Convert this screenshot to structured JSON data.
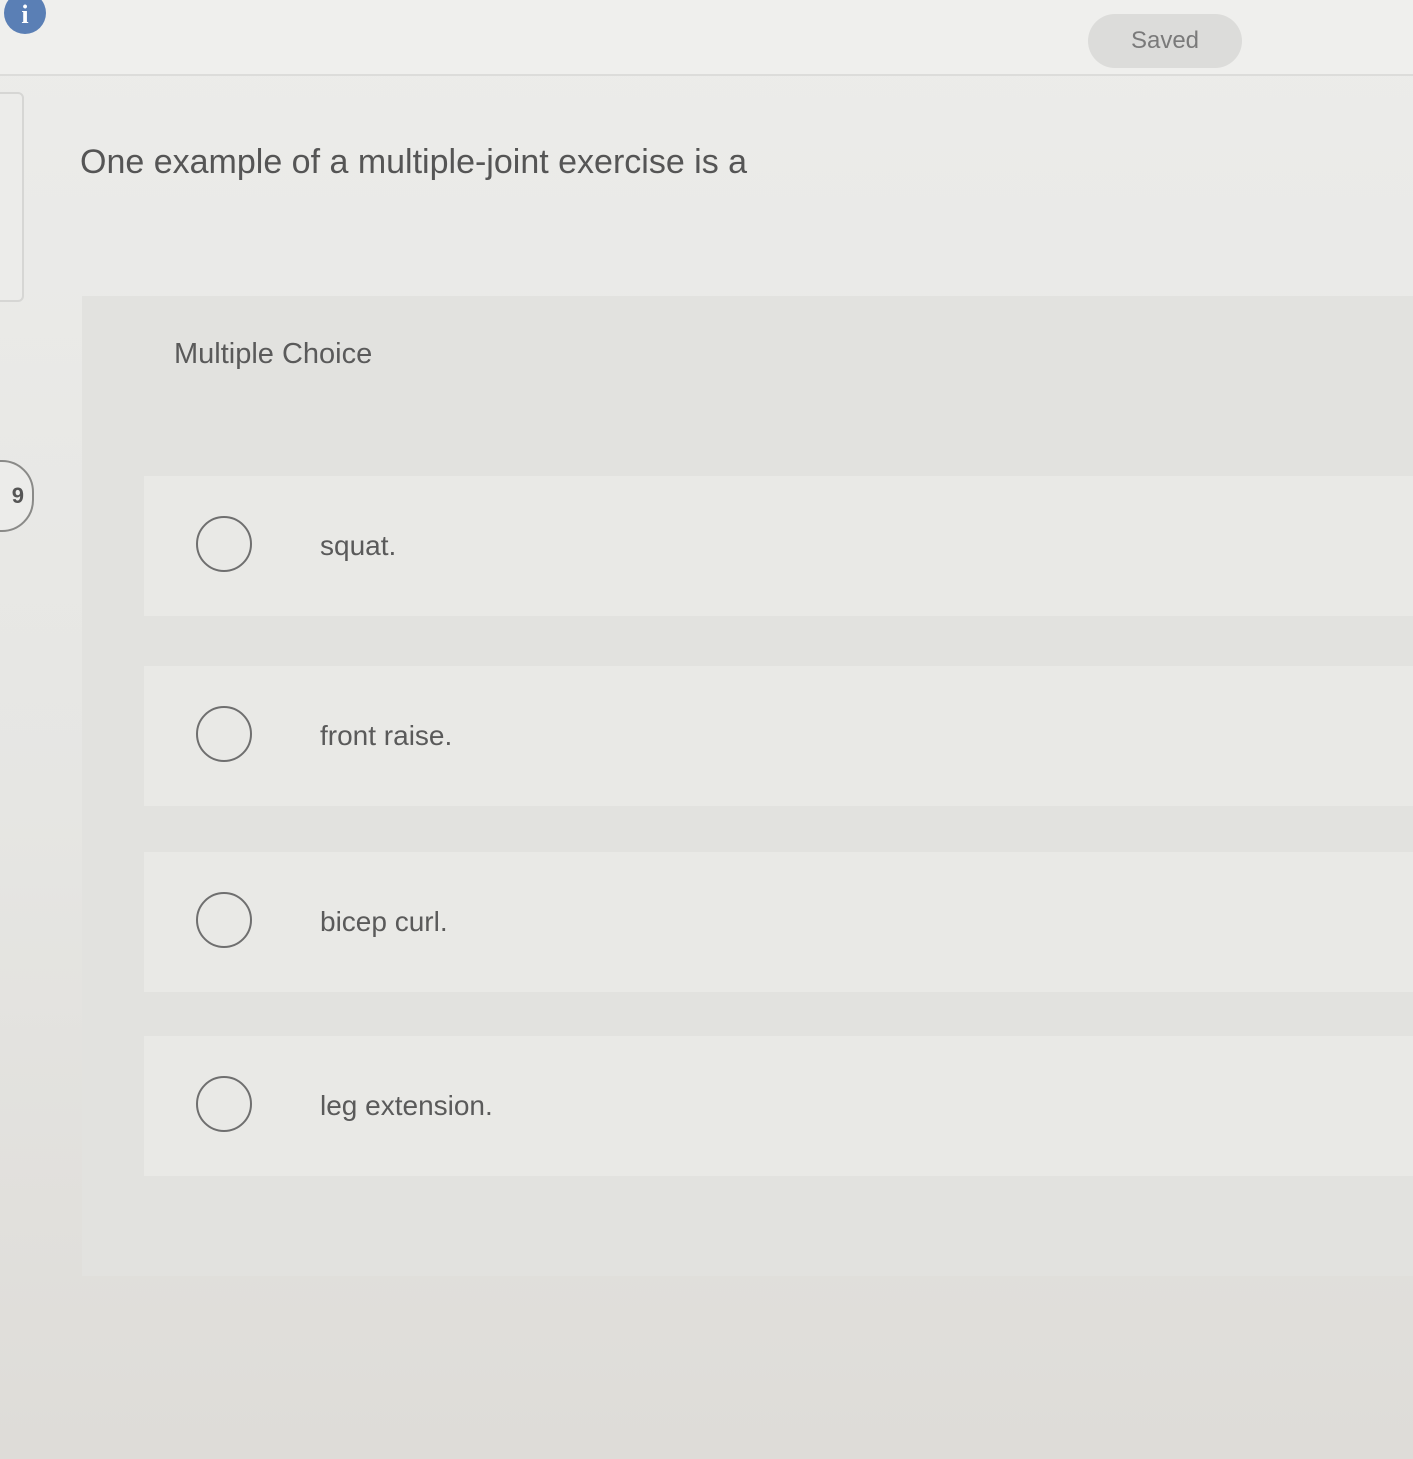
{
  "header": {
    "info_icon": "info-icon",
    "info_label": "i",
    "status": "Saved"
  },
  "question": {
    "number": "9",
    "text": "One example of a multiple-joint exercise is a"
  },
  "answer_panel": {
    "type_label": "Multiple Choice",
    "options": [
      {
        "label": "squat.",
        "selected": false
      },
      {
        "label": "front raise.",
        "selected": false
      },
      {
        "label": "bicep curl.",
        "selected": false
      },
      {
        "label": "leg extension.",
        "selected": false
      }
    ]
  }
}
